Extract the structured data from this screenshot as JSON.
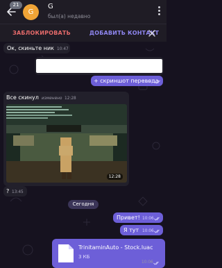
{
  "header": {
    "unread_count": "21",
    "avatar_letter": "G",
    "contact_name": "G",
    "contact_status": "был(а) недавно"
  },
  "action_bar": {
    "block_label": "ЗАБЛОКИРОВАТЬ",
    "add_contact_label": "ДОБАВИТЬ КОНТАКТ"
  },
  "messages": [
    {
      "direction": "in",
      "text": "Ок, скиньте ник",
      "time": "10:47"
    },
    {
      "direction": "in",
      "text": "",
      "time": "",
      "redacted": true
    },
    {
      "direction": "out",
      "text": "+ скриншот перевода",
      "time": "10:47",
      "status": "read"
    },
    {
      "direction": "in",
      "text": "Все скинул",
      "edited_label": "изменено",
      "time": "12:28"
    },
    {
      "direction": "in",
      "type": "image",
      "image_desc": "game-screenshot",
      "time": "12:28"
    },
    {
      "direction": "in",
      "text": "?",
      "time": "13:45"
    },
    {
      "direction": "out",
      "text": "Привет!",
      "time": "10:06",
      "status": "read"
    },
    {
      "direction": "out",
      "text": "Я тут",
      "time": "10:06",
      "status": "read"
    },
    {
      "direction": "out",
      "type": "file",
      "file_name": "TrinitaminAuto - Stock.luac",
      "file_size": "3 КБ",
      "time": "10:06",
      "status": "read"
    }
  ],
  "date_separator": "Сегодня",
  "colors": {
    "accent": "#6d5fd8",
    "block_red": "#e56a6a",
    "add_contact_purple": "#8f86f0",
    "avatar_orange": "#f0a436",
    "incoming_bubble": "#22202b",
    "background": "#16121f"
  }
}
